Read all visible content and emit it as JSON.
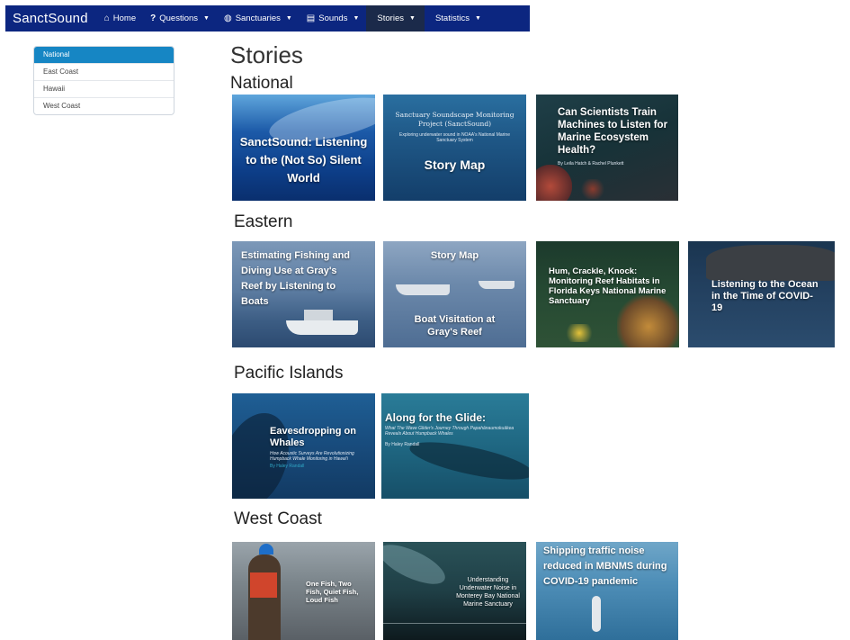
{
  "nav": {
    "brand": "SanctSound",
    "items": [
      {
        "label": "Home",
        "icon": "home-icon",
        "glyph": "⌂",
        "dropdown": false
      },
      {
        "label": "Questions",
        "icon": "question-icon",
        "glyph": "?",
        "dropdown": true
      },
      {
        "label": "Sanctuaries",
        "icon": "globe-icon",
        "glyph": "◍",
        "dropdown": true
      },
      {
        "label": "Sounds",
        "icon": "file-icon",
        "glyph": "▤",
        "dropdown": true
      },
      {
        "label": "Stories",
        "icon": "",
        "glyph": "",
        "dropdown": true,
        "active": true
      },
      {
        "label": "Statistics",
        "icon": "",
        "glyph": "",
        "dropdown": true
      }
    ]
  },
  "sidebar": {
    "items": [
      {
        "label": "National",
        "active": true
      },
      {
        "label": "East Coast"
      },
      {
        "label": "Hawaii"
      },
      {
        "label": "West Coast"
      }
    ]
  },
  "page": {
    "title": "Stories",
    "sections": {
      "national": "National",
      "eastern": "Eastern",
      "pacific": "Pacific Islands",
      "west": "West Coast"
    }
  },
  "cards": {
    "n1": {
      "title": "SanctSound: Listening to the (Not So) Silent World"
    },
    "n2": {
      "header": "Sanctuary Soundscape Monitoring Project (SanctSound)",
      "sub": "Exploring underwater sound in NOAA's National Marine Sanctuary System",
      "title": "Story Map"
    },
    "n3": {
      "title": "Can Scientists Train Machines to Listen for Marine Ecosystem Health?",
      "sub": "By Leila Hatch & Rachel Plunkett"
    },
    "e1": {
      "title": "Estimating Fishing and Diving Use at Gray's Reef by Listening to Boats"
    },
    "e2": {
      "title": "Story Map",
      "title2": "Boat Visitation at Gray's Reef"
    },
    "e3": {
      "title": "Hum, Crackle, Knock: Monitoring Reef Habitats in Florida Keys National Marine Sanctuary"
    },
    "e4": {
      "title": "Listening to the Ocean in the Time of COVID-19"
    },
    "p1": {
      "title": "Eavesdropping on Whales",
      "sub": "How Acoustic Surveys Are Revolutionizing Humpback Whale Monitoring in Hawai'i",
      "by": "By Haley Randall"
    },
    "p2": {
      "title": "Along for the Glide:",
      "sub": "What The Wave Glider's Journey Through Papahānaumokuākea Reveals About Humpback Whales",
      "by": "By Haley Randall"
    },
    "w1": {
      "title": "One Fish, Two Fish, Quiet Fish, Loud Fish"
    },
    "w2": {
      "title": "Understanding Underwater Noise in Monterey Bay National Marine Sanctuary"
    },
    "w3": {
      "title": "Shipping traffic noise reduced in MBNMS during COVID-19 pandemic"
    }
  },
  "colors": {
    "navbar": "#0c2680",
    "active_nav": "#1b2a4a",
    "sidebar_active": "#1686c4"
  }
}
